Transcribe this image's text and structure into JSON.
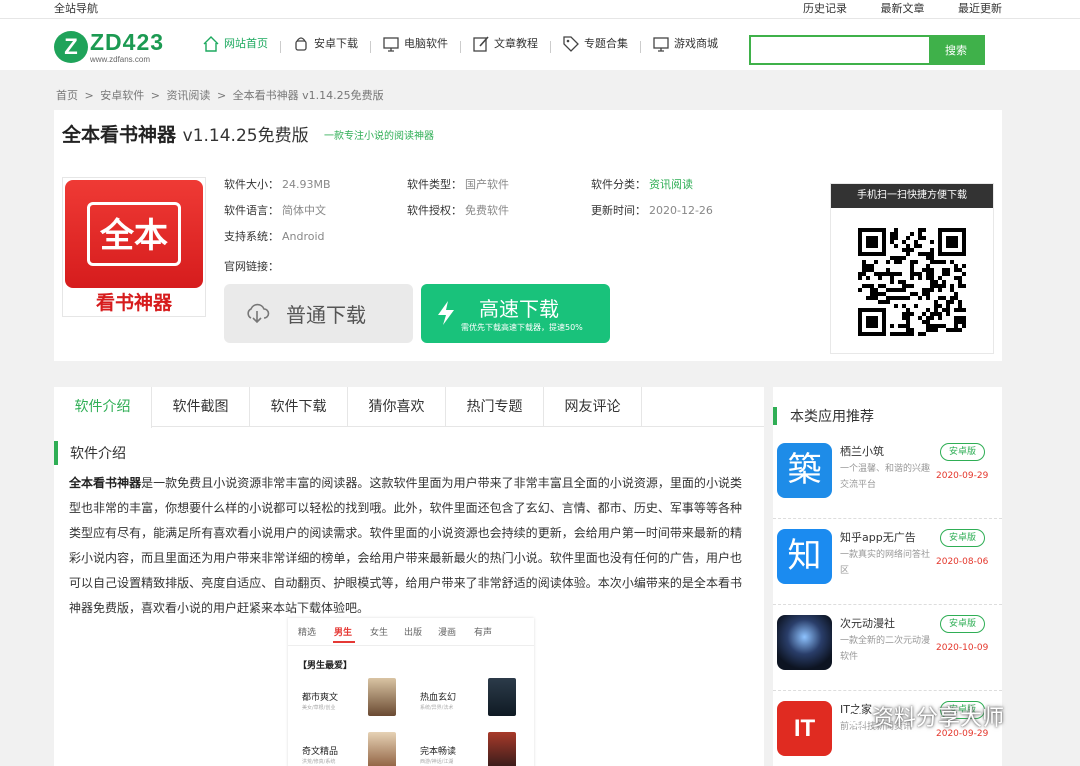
{
  "topbar": {
    "left": "全站导航",
    "right": [
      "历史记录",
      "最新文章",
      "最近更新"
    ]
  },
  "logo": {
    "mark": "Z",
    "text": "ZD423",
    "url": "www.zdfans.com"
  },
  "nav": [
    {
      "label": "网站首页",
      "icon": "home-icon"
    },
    {
      "label": "安卓下载",
      "icon": "android-icon"
    },
    {
      "label": "电脑软件",
      "icon": "monitor-icon"
    },
    {
      "label": "文章教程",
      "icon": "edit-icon"
    },
    {
      "label": "专题合集",
      "icon": "tag-icon"
    },
    {
      "label": "游戏商城",
      "icon": "monitor-icon"
    }
  ],
  "search": {
    "value": "",
    "placeholder": "",
    "button": "搜索"
  },
  "breadcrumb": [
    "首页",
    ">",
    "安卓软件",
    ">",
    "资讯阅读",
    ">",
    "全本看书神器 v1.14.25免费版"
  ],
  "app": {
    "name": "全本看书神器",
    "version": "v1.14.25免费版",
    "slogan": "一款专注小说的阅读神器",
    "icon_text": "全本",
    "icon_sub": "看书神器",
    "info": {
      "size_label": "软件大小：",
      "size": "24.93MB",
      "type_label": "软件类型：",
      "type": "国产软件",
      "cat_label": "软件分类：",
      "cat": "资讯阅读",
      "lang_label": "软件语言：",
      "lang": "简体中文",
      "license_label": "软件授权：",
      "license": "免费软件",
      "update_label": "更新时间：",
      "update": "2020-12-26",
      "os_label": "支持系统：",
      "os": "Android",
      "site_label": "官网链接："
    },
    "btn_normal": "普通下载",
    "btn_fast": "高速下载",
    "btn_fast_sub": "需优先下载高速下载器，提速50%",
    "qr_title": "手机扫一扫快捷方便下载"
  },
  "tabs": [
    "软件介绍",
    "软件截图",
    "软件下载",
    "猜你喜欢",
    "热门专题",
    "网友评论"
  ],
  "section_title": "软件介绍",
  "intro": {
    "bold": "全本看书神器",
    "text": "是一款免费且小说资源非常丰富的阅读器。这款软件里面为用户带来了非常丰富且全面的小说资源，里面的小说类型也非常的丰富，你想要什么样的小说都可以轻松的找到哦。此外，软件里面还包含了玄幻、言情、都市、历史、军事等等各种类型应有尽有，能满足所有喜欢看小说用户的阅读需求。软件里面的小说资源也会持续的更新，会给用户第一时间带来最新的精彩小说内容，而且里面还为用户带来非常详细的榜单，会给用户带来最新最火的热门小说。软件里面也没有任何的广告，用户也可以自己设置精致排版、亮度自适应、自动翻页、护眼模式等，给用户带来了非常舒适的阅读体验。本次小编带来的是全本看书神器免费版，喜欢看小说的用户赶紧来本站下载体验吧。"
  },
  "screenshot": {
    "tabs": [
      "精选",
      "男生",
      "女生",
      "出版",
      "漫画",
      "有声"
    ],
    "block_title": "【男生最爱】",
    "cards": [
      {
        "title": "都市爽文",
        "sub": "美女/草根/创业"
      },
      {
        "title": "热血玄幻",
        "sub": "系统/异界/法术"
      },
      {
        "title": "奇文精品",
        "sub": "洪荒/修真/系统"
      },
      {
        "title": "完本畅读",
        "sub": "西游/神话/江湖"
      }
    ]
  },
  "sidebar": {
    "title": "本类应用推荐",
    "items": [
      {
        "name": "栖兰小筑",
        "desc": "一个温馨、和谐的兴趣交流平台",
        "badge": "安卓版",
        "date": "2020-09-29",
        "icon": "app-icon-qilan",
        "icon_text": "築",
        "color": "#1e8ce8"
      },
      {
        "name": "知乎app无广告",
        "desc": "一款真实的网络问答社区",
        "badge": "安卓版",
        "date": "2020-08-06",
        "icon": "app-icon-zhihu",
        "icon_text": "知",
        "color": "#1b8bf0"
      },
      {
        "name": "次元动漫社",
        "desc": "一款全新的二次元动漫软件",
        "badge": "安卓版",
        "date": "2020-10-09",
        "icon": "app-icon-ciyuan",
        "icon_text": "",
        "color": "#1a2436"
      },
      {
        "name": "IT之家",
        "desc": "前沿科技新闻资讯",
        "badge": "安卓版",
        "date": "2020-09-29",
        "icon": "app-icon-ithome",
        "icon_text": "IT",
        "color": "#e02b21"
      }
    ]
  },
  "watermark": "资料分享大师"
}
